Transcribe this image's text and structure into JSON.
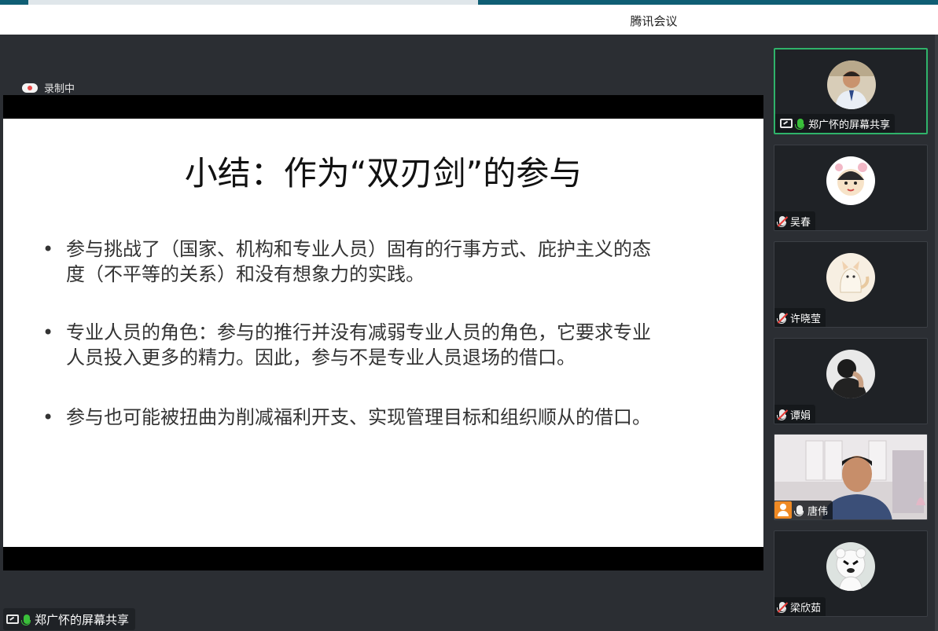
{
  "window": {
    "title": "腾讯会议"
  },
  "recording": {
    "label": "录制中"
  },
  "slide": {
    "title": "小结：作为“双刃剑”的参与",
    "bullets": [
      {
        "symbol": "•",
        "lines": [
          "参与挑战了（国家、机构和专业人员）固有的行事方式、庇护主义的态",
          "度（不平等的关系）和没有想象力的实践。"
        ]
      },
      {
        "symbol": "•",
        "lines": [
          "专业人员的角色：参与的推行并没有减弱专业人员的角色，它要求专业",
          "人员投入更多的精力。因此，参与不是专业人员退场的借口。"
        ]
      },
      {
        "symbol": "•",
        "lines": [
          "参与也可能被扭曲为削减福利开支、实现管理目标和组织顺从的借口。"
        ]
      }
    ]
  },
  "share_label": {
    "name": "郑广怀的屏幕共享"
  },
  "participants": [
    {
      "name": "郑广怀的屏幕共享",
      "mic": "on",
      "icon": "screen-share-icon",
      "active": true
    },
    {
      "name": "吴春",
      "mic": "muted"
    },
    {
      "name": "许晓莹",
      "mic": "muted"
    },
    {
      "name": "谭娟",
      "mic": "muted"
    },
    {
      "name": "唐伟",
      "mic": "on-white",
      "icon": "person-icon",
      "video": true
    },
    {
      "name": "梁欣茹",
      "mic": "muted"
    }
  ]
}
